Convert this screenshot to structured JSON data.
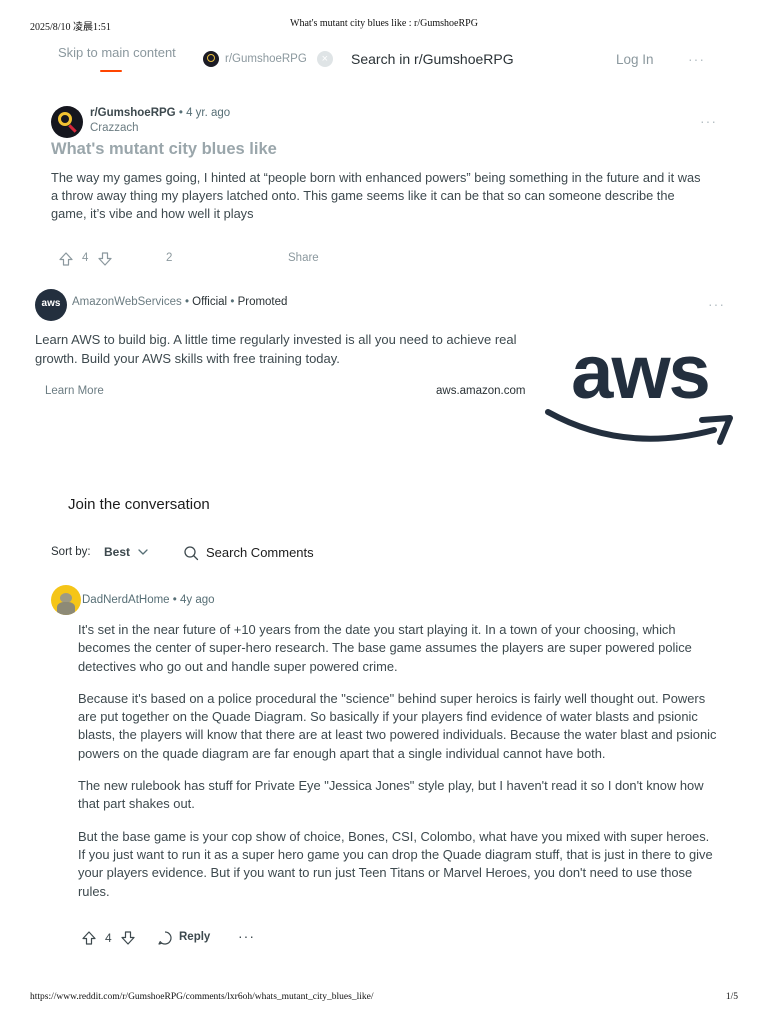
{
  "print_header": {
    "date": "2025/8/10 凌晨1:51",
    "title": "What's mutant city blues like : r/GumshoeRPG"
  },
  "print_footer": {
    "url": "https://www.reddit.com/r/GumshoeRPG/comments/lxr6oh/whats_mutant_city_blues_like/",
    "page": "1/5"
  },
  "nav": {
    "skip_link": "Skip to main content",
    "subreddit_chip": "r/GumshoeRPG",
    "chip_close": "×",
    "search_label": "Search in r/GumshoeRPG",
    "login": "Log In",
    "more": "···"
  },
  "post": {
    "subreddit": "r/GumshoeRPG",
    "separator": "•",
    "age": "4 yr. ago",
    "author": "Crazzach",
    "more": "···",
    "title": "What's mutant city blues like",
    "body": "The way my games going, I hinted at “people born with enhanced powers” being something in the future and it was a throw away thing my players latched onto. This game seems like it can be that so can someone describe the game, it’s vibe and how well it plays",
    "votes": "4",
    "comments": "2",
    "share": "Share"
  },
  "ad": {
    "avatar_text": "aws",
    "advertiser": "AmazonWebServices",
    "separator": "•",
    "official": "Official",
    "promoted": "Promoted",
    "more": "···",
    "body": "Learn AWS to build big. A little time regularly invested is all you need to achieve real growth. Build your AWS skills with free training today.",
    "cta": "Learn More",
    "domain": "aws.amazon.com",
    "logo_text": "aws",
    "logo_text_color": "#232f3e",
    "logo_smile_color": "#232f3e"
  },
  "comments_section": {
    "join": "Join the conversation",
    "sort_label": "Sort by:",
    "sort_value": "Best",
    "search": "Search Comments"
  },
  "comment": {
    "user": "DadNerdAtHome",
    "separator": "•",
    "age": "4y ago",
    "paragraphs": [
      "It's set in the near future of +10 years from the date you start playing it. In a town of your choosing, which becomes the center of super-hero research. The base game assumes the players are super powered police detectives who go out and handle super powered crime.",
      "Because it's based on a police procedural the \"science\" behind super heroics is fairly well thought out. Powers are put together on the Quade Diagram. So basically if your players find evidence of water blasts and psionic blasts, the players will know that there are at least two powered individuals. Because the water blast and psionic powers on the quade diagram are far enough apart that a single individual cannot have both.",
      "The new rulebook has stuff for Private Eye \"Jessica Jones\" style play, but I haven't read it so I don't know how that part shakes out.",
      "But the base game is your cop show of choice, Bones, CSI, Colombo, what have you mixed with super heroes. If you just want to run it as a super hero game you can drop the Quade diagram stuff, that is just in there to give your players evidence. But if you want to run just Teen Titans or Marvel Heroes, you don't need to use those rules."
    ],
    "votes": "4",
    "reply": "Reply",
    "more": "···"
  },
  "colors": {
    "accent": "#ff4500",
    "muted": "#8b989e",
    "text": "#3d494e"
  }
}
